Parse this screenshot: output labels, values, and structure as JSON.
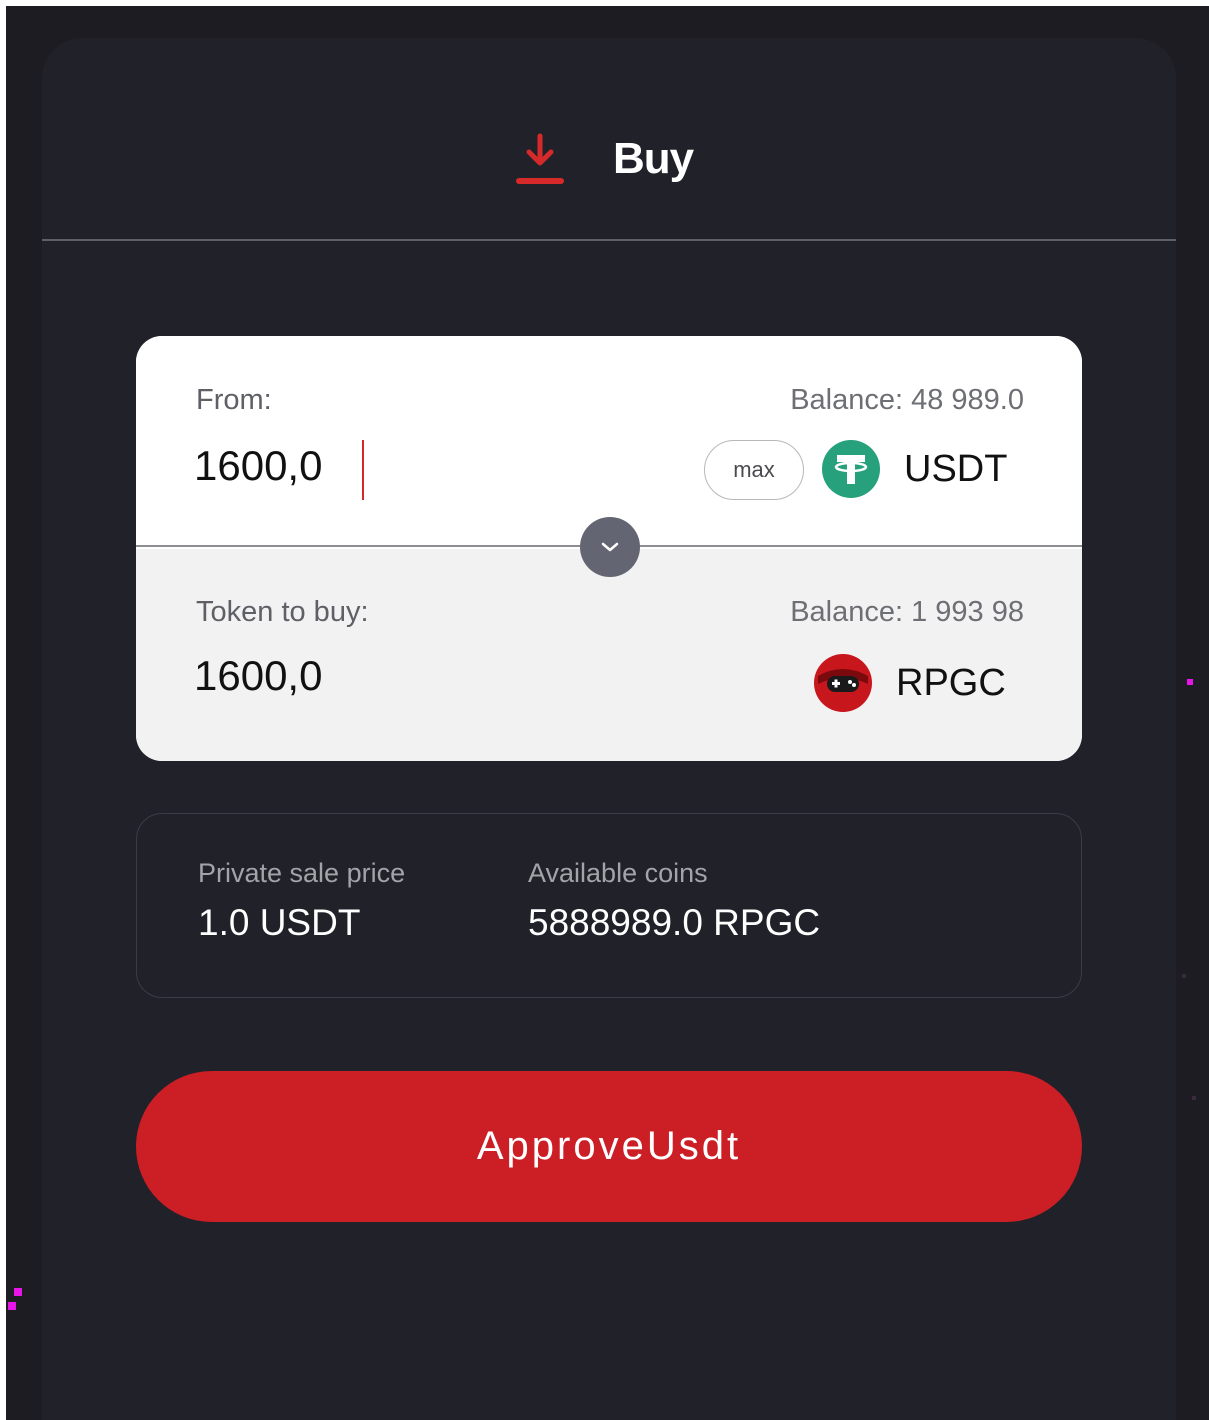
{
  "colors": {
    "background": "#1c1c22",
    "panel": "#202129",
    "accent": "#cc1e25",
    "particle": "#e617e6"
  },
  "header": {
    "tab_icon": "download-arrow-icon",
    "tab_label": "Buy"
  },
  "from": {
    "label": "From:",
    "balance": "Balance: 48 989.0",
    "amount": "1600,0",
    "max_label": "max",
    "token_icon": "tether-icon",
    "token": "USDT"
  },
  "switch": {
    "icon": "chevron-down-icon"
  },
  "to": {
    "label": "Token to buy:",
    "balance": "Balance: 1 993 98",
    "amount": "1600,0",
    "token_icon": "gamepad-icon",
    "token": "RPGC"
  },
  "info": {
    "price_label": "Private sale price",
    "price_value": "1.0 USDT",
    "available_label": "Available coins",
    "available_value": "5888989.0 RPGC"
  },
  "approve_button": {
    "label": "ApproveUsdt"
  }
}
